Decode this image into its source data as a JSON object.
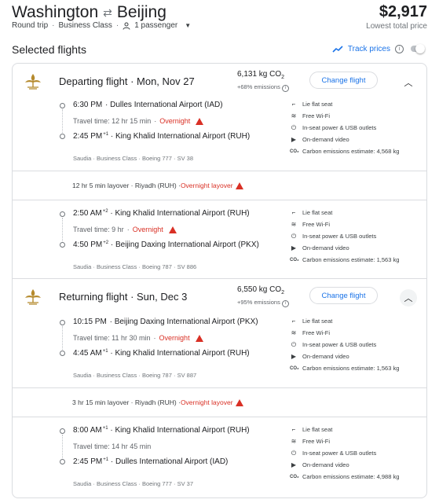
{
  "header": {
    "origin": "Washington",
    "destination": "Beijing",
    "trip_type": "Round trip",
    "cabin": "Business Class",
    "passengers": "1 passenger",
    "price": "$2,917",
    "price_label": "Lowest total price"
  },
  "selected": {
    "title": "Selected flights",
    "track_label": "Track prices"
  },
  "departing": {
    "title": "Departing flight",
    "date": "Mon, Nov 27",
    "co2_value": "6,131 kg CO",
    "co2_sub": "2",
    "co2_pct": "+68% emissions",
    "change_label": "Change flight",
    "legs": [
      {
        "dep_time": "6:30 PM",
        "dep_sup": "",
        "dep_airport": "Dulles International Airport (IAD)",
        "travel_time": "Travel time: 12 hr 15 min",
        "overnight": "Overnight",
        "arr_time": "2:45 PM",
        "arr_sup": "+1",
        "arr_airport": "King Khalid International Airport (RUH)",
        "meta": "Saudia · Business Class · Boeing 777 · SV 38",
        "amenities": [
          "Lie flat seat",
          "Free Wi-Fi",
          "In-seat power & USB outlets",
          "On-demand video",
          "Carbon emissions estimate: 4,568 kg"
        ]
      },
      {
        "dep_time": "2:50 AM",
        "dep_sup": "+2",
        "dep_airport": "King Khalid International Airport (RUH)",
        "travel_time": "Travel time: 9 hr",
        "overnight": "Overnight",
        "arr_time": "4:50 PM",
        "arr_sup": "+2",
        "arr_airport": "Beijing Daxing International Airport (PKX)",
        "meta": "Saudia · Business Class · Boeing 787 · SV 886",
        "amenities": [
          "Lie flat seat",
          "Free Wi-Fi",
          "In-seat power & USB outlets",
          "On-demand video",
          "Carbon emissions estimate: 1,563 kg"
        ]
      }
    ],
    "layover": "12 hr 5 min layover · Riyadh (RUH) · ",
    "layover_warn": "Overnight layover"
  },
  "returning": {
    "title": "Returning flight",
    "date": "Sun, Dec 3",
    "co2_value": "6,550 kg CO",
    "co2_sub": "2",
    "co2_pct": "+95% emissions",
    "change_label": "Change flight",
    "legs": [
      {
        "dep_time": "10:15 PM",
        "dep_sup": "",
        "dep_airport": "Beijing Daxing International Airport (PKX)",
        "travel_time": "Travel time: 11 hr 30 min",
        "overnight": "Overnight",
        "arr_time": "4:45 AM",
        "arr_sup": "+1",
        "arr_airport": "King Khalid International Airport (RUH)",
        "meta": "Saudia · Business Class · Boeing 787 · SV 887",
        "amenities": [
          "Lie flat seat",
          "Free Wi-Fi",
          "In-seat power & USB outlets",
          "On-demand video",
          "Carbon emissions estimate: 1,563 kg"
        ]
      },
      {
        "dep_time": "8:00 AM",
        "dep_sup": "+1",
        "dep_airport": "King Khalid International Airport (RUH)",
        "travel_time": "Travel time: 14 hr 45 min",
        "overnight": "",
        "arr_time": "2:45 PM",
        "arr_sup": "+1",
        "arr_airport": "Dulles International Airport (IAD)",
        "meta": "Saudia · Business Class · Boeing 777 · SV 37",
        "amenities": [
          "Lie flat seat",
          "Free Wi-Fi",
          "In-seat power & USB outlets",
          "On-demand video",
          "Carbon emissions estimate: 4,988 kg"
        ]
      }
    ],
    "layover": "3 hr 15 min layover · Riyadh (RUH) · ",
    "layover_warn": "Overnight layover"
  },
  "icons": {
    "airline_logo": "saudia-logo-icon",
    "seat": "seat-icon",
    "wifi": "wifi-icon",
    "power": "power-plug-icon",
    "video": "video-icon",
    "co2": "co2-icon",
    "accent": "#1a73e8",
    "warning": "#d93025",
    "logo_color": "#b58a2d"
  }
}
